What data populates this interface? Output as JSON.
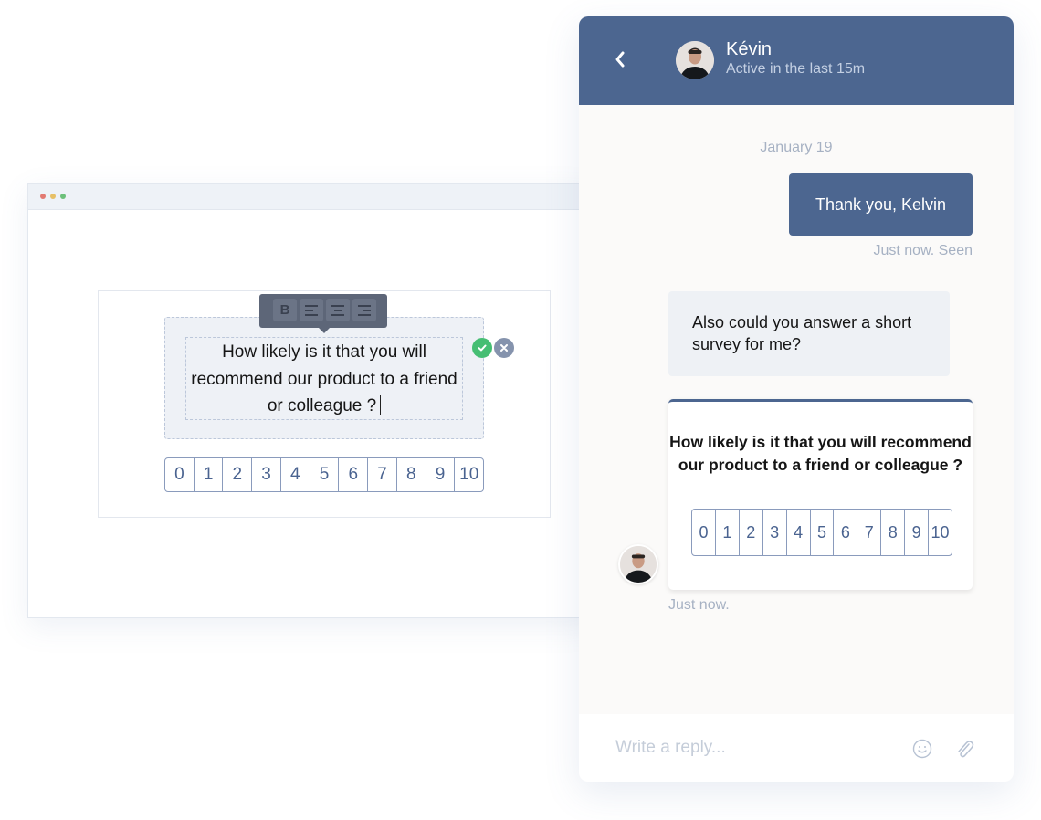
{
  "browser": {
    "window_controls": [
      "close",
      "minimize",
      "maximize"
    ],
    "editor": {
      "question": "How likely is it that you will recommend our product to a friend or colleague ?",
      "toolbar": {
        "bold_label": "B",
        "buttons": [
          "bold",
          "align-left",
          "align-center",
          "align-right"
        ]
      },
      "confirm_icon": "check-icon",
      "cancel_icon": "close-icon"
    },
    "scale": [
      "0",
      "1",
      "2",
      "3",
      "4",
      "5",
      "6",
      "7",
      "8",
      "9",
      "10"
    ]
  },
  "chat": {
    "colors": {
      "accent": "#4c6690",
      "confirm": "#46be73",
      "cancel": "#8593ad"
    },
    "header": {
      "back_icon": "chevron-left-icon",
      "name": "Kévin",
      "status": "Active in the last 15m"
    },
    "date_separator": "January 19",
    "messages": [
      {
        "direction": "outgoing",
        "text": "Thank you, Kelvin",
        "meta": "Just now. Seen"
      },
      {
        "direction": "incoming",
        "text": "Also could you answer a short survey for me?"
      }
    ],
    "survey": {
      "question": "How likely is it that you will recommend our product to a friend or colleague ?",
      "scale": [
        "0",
        "1",
        "2",
        "3",
        "4",
        "5",
        "6",
        "7",
        "8",
        "9",
        "10"
      ],
      "meta": "Just now."
    },
    "composer": {
      "placeholder": "Write a reply...",
      "value": "",
      "emoji_icon": "smiley-icon",
      "attach_icon": "paperclip-icon"
    }
  }
}
